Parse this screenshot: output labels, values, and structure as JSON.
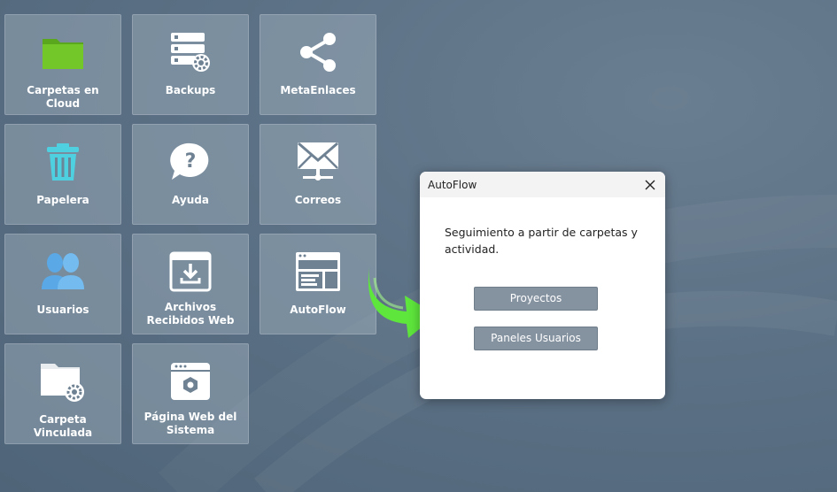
{
  "tiles": [
    {
      "label": "Carpetas en Cloud",
      "icon": "folder-icon"
    },
    {
      "label": "Backups",
      "icon": "backup-server-icon"
    },
    {
      "label": "MetaEnlaces",
      "icon": "share-icon"
    },
    {
      "label": "Papelera",
      "icon": "trash-icon"
    },
    {
      "label": "Ayuda",
      "icon": "help-icon"
    },
    {
      "label": "Correos",
      "icon": "mail-icon"
    },
    {
      "label": "Usuarios",
      "icon": "users-icon"
    },
    {
      "label": "Archivos Recibidos Web",
      "icon": "download-box-icon"
    },
    {
      "label": "AutoFlow",
      "icon": "layout-window-icon"
    },
    {
      "label": "Carpeta Vinculada",
      "icon": "linked-folder-icon"
    },
    {
      "label": "Página Web del Sistema",
      "icon": "web-settings-icon"
    }
  ],
  "dialog": {
    "title": "AutoFlow",
    "message": "Seguimiento a partir de carpetas y actividad.",
    "buttons": {
      "projects": "Proyectos",
      "user_panels": "Paneles Usuarios"
    }
  },
  "colors": {
    "accent_arrow": "#5ee63c",
    "folder_green": "#6cc124",
    "trash_teal": "#4fd0e0",
    "users_blue": "#5aa9e6",
    "button_gray": "#8592a0"
  }
}
